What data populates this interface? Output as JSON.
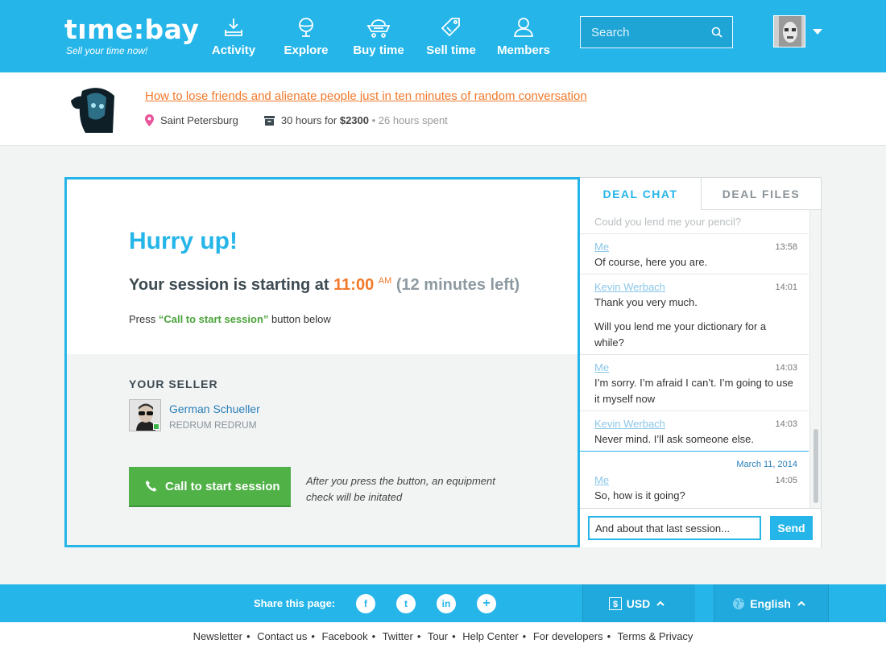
{
  "brand": {
    "name": "tıme:bay",
    "tagline": "Sell your time now!"
  },
  "nav": [
    {
      "label": "Activity",
      "icon": "activity-icon"
    },
    {
      "label": "Explore",
      "icon": "globe-icon"
    },
    {
      "label": "Buy time",
      "icon": "cart-icon"
    },
    {
      "label": "Sell time",
      "icon": "tag-icon"
    },
    {
      "label": "Members",
      "icon": "members-icon"
    }
  ],
  "search": {
    "placeholder": "Search",
    "value": ""
  },
  "listing": {
    "title": "How to lose friends and alienate people just in ten minutes of random conversation",
    "city": "Saint Petersburg",
    "hours_prefix": "30 hours for ",
    "price": "$2300",
    "spent": " • 26 hours spent"
  },
  "session": {
    "heading": "Hurry up!",
    "starting_text": "Your session is starting at ",
    "time": "11:00",
    "ampm": "AM",
    "remaining": " (12 minutes left)",
    "press_prefix": "Press ",
    "press_button_ref": "“Call to start session”",
    "press_suffix": " button below",
    "seller_heading": "YOUR SELLER",
    "seller_name": "German Schueller",
    "seller_sub": "REDRUM REDRUM",
    "call_label": "Call to start session",
    "call_note": "After you press the button, an equipment check will be initated"
  },
  "chat": {
    "tabs": [
      "DEAL CHAT",
      "DEAL FILES"
    ],
    "faded_line": "Could you lend me your pencil?",
    "messages": [
      {
        "who": "Me",
        "time": "13:58",
        "lines": [
          "Of course, here you are."
        ]
      },
      {
        "who": "Kevin Werbach",
        "time": "14:01",
        "lines": [
          "Thank you very much.",
          "Will you lend me your dictionary for a while?"
        ]
      },
      {
        "who": "Me",
        "time": "14:03",
        "lines": [
          "I’m sorry. I’m afraid I can’t. I’m going to use it myself now"
        ]
      },
      {
        "who": "Kevin Werbach",
        "time": "14:03",
        "lines": [
          "Never mind. I’ll ask someone else."
        ]
      },
      {
        "date": "March 11, 2014",
        "who": "Me",
        "time": "14:05",
        "lines": [
          "So, how is it going?"
        ]
      }
    ],
    "input_value": "And about that last session...",
    "send_label": "Send"
  },
  "footer": {
    "share_label": "Share this page:",
    "social": [
      "f",
      "t",
      "in",
      "+"
    ],
    "currency": "USD",
    "language": "English",
    "links": [
      "Newsletter",
      "Contact us",
      "Facebook",
      "Twitter",
      "Tour",
      "Help Center",
      "For developers",
      "Terms & Privacy"
    ]
  },
  "colors": {
    "accent": "#25b5e9",
    "orange": "#f2792b",
    "green": "#4fb146"
  }
}
